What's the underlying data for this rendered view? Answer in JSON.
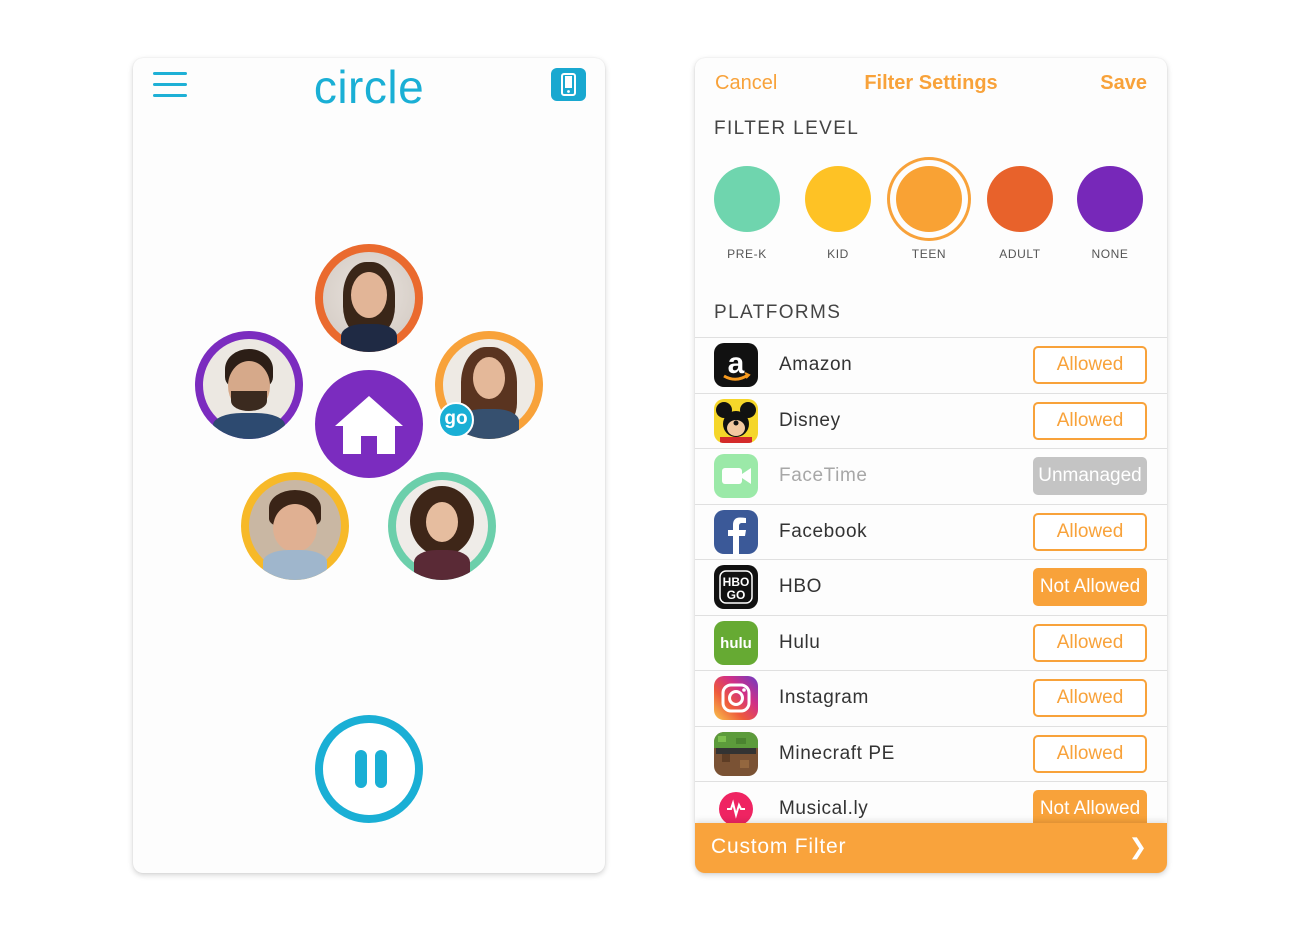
{
  "home": {
    "logo": "circle",
    "menu_icon": "hamburger-menu-icon",
    "device_icon": "phone-icon",
    "home_icon": "house-icon",
    "go_badge": "go",
    "pause_icon": "pause-icon",
    "members": [
      {
        "name": "woman",
        "ring_color": "#ea6a2e"
      },
      {
        "name": "man",
        "ring_color": "#7b2cbf"
      },
      {
        "name": "girl",
        "ring_color": "#f8a23a"
      },
      {
        "name": "boy",
        "ring_color": "#f7b928"
      },
      {
        "name": "curly-girl",
        "ring_color": "#6ccfab"
      }
    ],
    "colors": {
      "accent": "#1aafd5",
      "home": "#7b2cbf"
    }
  },
  "filter_settings": {
    "cancel_label": "Cancel",
    "title": "Filter Settings",
    "save_label": "Save",
    "filter_level_heading": "FILTER LEVEL",
    "levels": [
      {
        "label": "PRE-K",
        "color": "#6fd5ae"
      },
      {
        "label": "KID",
        "color": "#fec225"
      },
      {
        "label": "TEEN",
        "color": "#f9a234",
        "selected": true
      },
      {
        "label": "ADULT",
        "color": "#e8622b"
      },
      {
        "label": "NONE",
        "color": "#7728b9"
      }
    ],
    "platforms_heading": "PLATFORMS",
    "platforms": [
      {
        "name": "Amazon",
        "status": "Allowed",
        "icon": "amazon-icon"
      },
      {
        "name": "Disney",
        "status": "Allowed",
        "icon": "disney-icon"
      },
      {
        "name": "FaceTime",
        "status": "Unmanaged",
        "icon": "facetime-icon"
      },
      {
        "name": "Facebook",
        "status": "Allowed",
        "icon": "facebook-icon"
      },
      {
        "name": "HBO",
        "status": "Not Allowed",
        "icon": "hbo-go-icon"
      },
      {
        "name": "Hulu",
        "status": "Allowed",
        "icon": "hulu-icon"
      },
      {
        "name": "Instagram",
        "status": "Allowed",
        "icon": "instagram-icon"
      },
      {
        "name": "Minecraft PE",
        "status": "Allowed",
        "icon": "minecraft-icon"
      },
      {
        "name": "Musical.ly",
        "status": "Not Allowed",
        "icon": "musically-icon"
      }
    ],
    "custom_filter_label": "Custom Filter",
    "custom_filter_icon": "chevron-right-icon",
    "colors": {
      "accent": "#f8a23a",
      "unmanaged": "#c4c4c4"
    }
  }
}
